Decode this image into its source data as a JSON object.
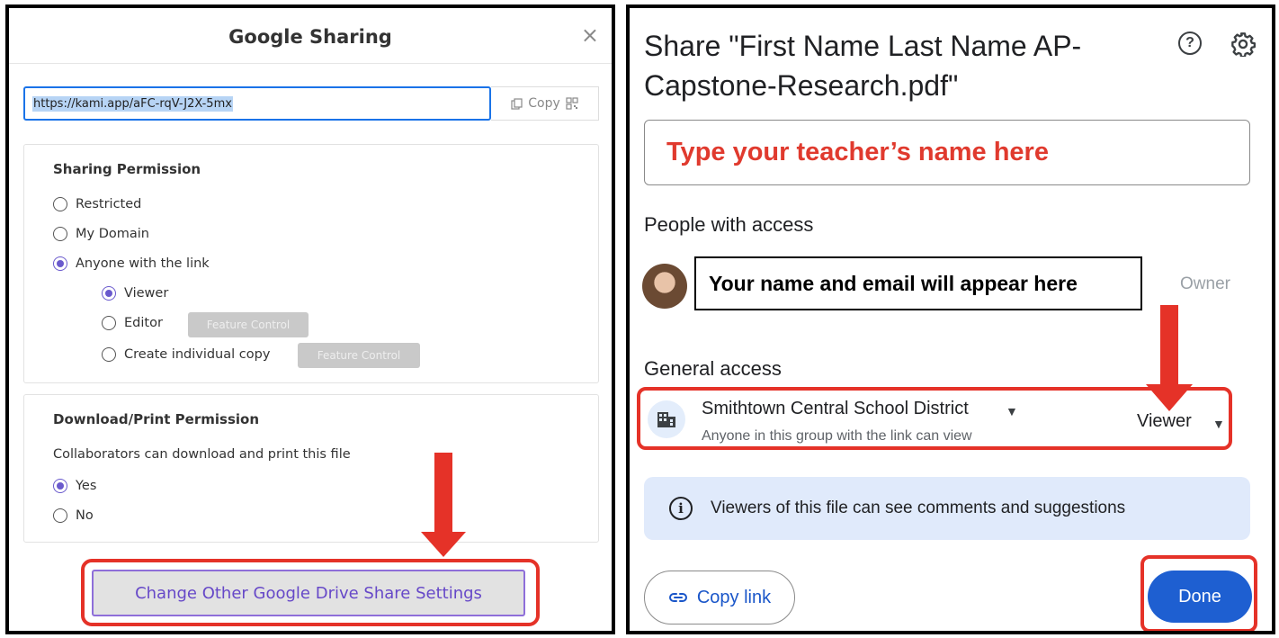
{
  "kami": {
    "title": "Google Sharing",
    "close_symbol": "×",
    "url": "https://kami.app/aFC-rqV-J2X-5mx",
    "copy_label": "Copy",
    "sharing_permission": {
      "title": "Sharing Permission",
      "options": [
        "Restricted",
        "My Domain",
        "Anyone with the link"
      ],
      "selected": "Anyone with the link",
      "sub_options": [
        "Viewer",
        "Editor",
        "Create individual copy"
      ],
      "sub_selected": "Viewer",
      "feature_control_label": "Feature Control"
    },
    "download_permission": {
      "title": "Download/Print Permission",
      "description": "Collaborators can download and print this file",
      "options": [
        "Yes",
        "No"
      ],
      "selected": "Yes"
    },
    "change_button": "Change Other Google Drive Share Settings"
  },
  "drive": {
    "title": "Share \"First Name Last Name AP-Capstone-Research.pdf\"",
    "help_symbol": "?",
    "name_input_hint": "Type your teacher’s name here",
    "people_heading": "People with access",
    "person_placeholder": "Your name and email will appear here",
    "owner_label": "Owner",
    "general_heading": "General access",
    "group_name": "Smithtown Central School District",
    "group_description": "Anyone in this group with the link can view",
    "role": "Viewer",
    "info_symbol": "i",
    "info_text": "Viewers of this file can see comments and suggestions",
    "copy_link_label": "Copy link",
    "done_label": "Done"
  },
  "colors": {
    "annotation_red": "#e53228",
    "kami_purple": "#6a5acd",
    "google_blue": "#1e5fd1",
    "hint_red": "#e03a2e"
  },
  "icons": {
    "kami": [
      "close-icon",
      "copy-icon",
      "qr-code-icon"
    ],
    "drive": [
      "help-icon",
      "gear-icon",
      "building-icon",
      "dropdown-caret-icon",
      "info-icon",
      "link-icon"
    ]
  }
}
